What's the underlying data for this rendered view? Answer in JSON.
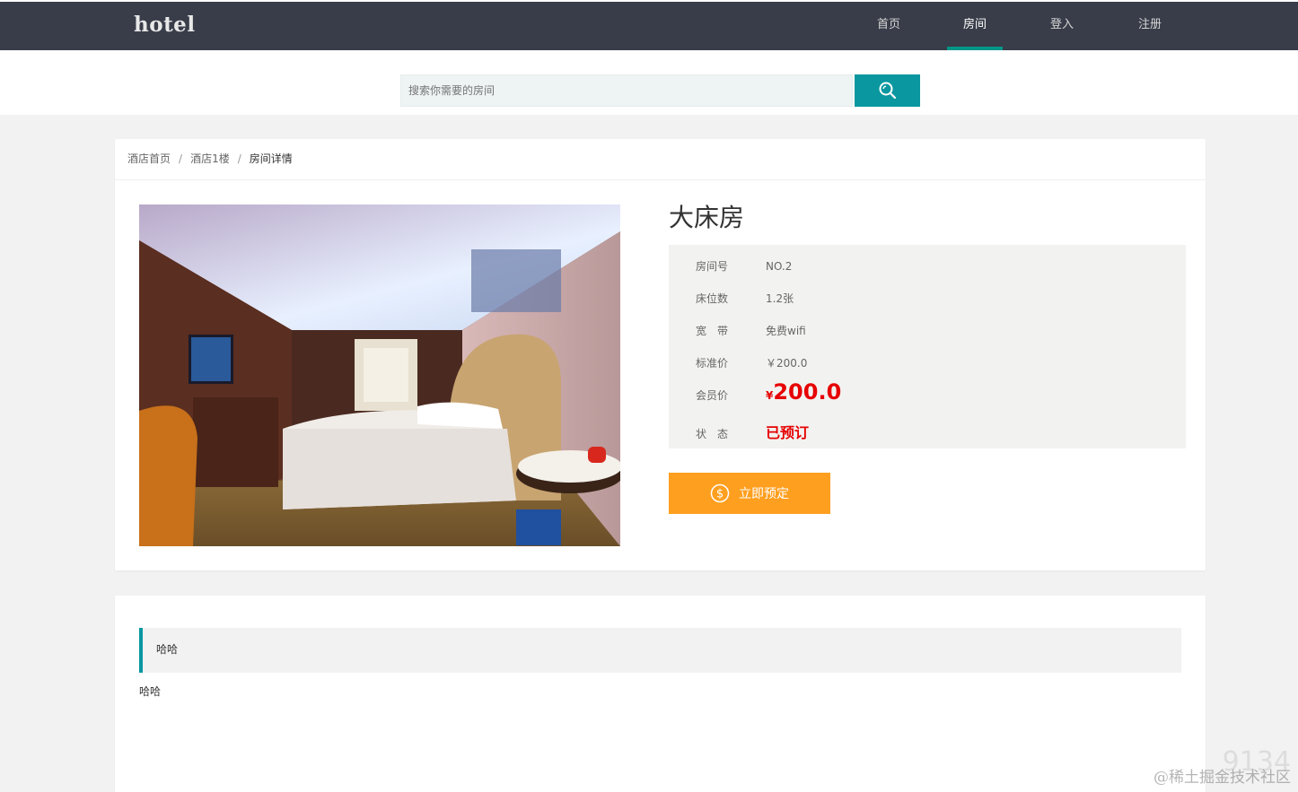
{
  "header": {
    "logo": "hotel",
    "nav": [
      {
        "label": "首页",
        "active": false
      },
      {
        "label": "房间",
        "active": true
      },
      {
        "label": "登入",
        "active": false
      },
      {
        "label": "注册",
        "active": false
      }
    ]
  },
  "search": {
    "placeholder": "搜索你需要的房间",
    "button_icon": "search-icon"
  },
  "breadcrumb": {
    "home": "酒店首页",
    "floor": "酒店1楼",
    "current": "房间详情",
    "separator": "/"
  },
  "room": {
    "title": "大床房",
    "image_alt": "hotel room photo",
    "details": [
      {
        "key": "房间号",
        "value": "NO.2"
      },
      {
        "key": "床位数",
        "value": "1.2张"
      },
      {
        "key": "宽　带",
        "value": "免费wifi"
      },
      {
        "key": "标准价",
        "value": "￥200.0"
      }
    ],
    "member_price_label": "会员价",
    "member_price_currency": "¥",
    "member_price": "200.0",
    "status_label": "状　态",
    "status": "已预订",
    "book_button": "立即预定",
    "book_button_icon": "dollar-circle-icon"
  },
  "description": {
    "title": "哈哈",
    "text": "哈哈"
  },
  "watermark": "@稀土掘金技术社区",
  "watermark_bg": "9134",
  "colors": {
    "topbar": "#393d49",
    "accent": "#009688",
    "search_button": "#0a97a0",
    "book_button": "#ff9f1f",
    "price": "#e60000"
  }
}
